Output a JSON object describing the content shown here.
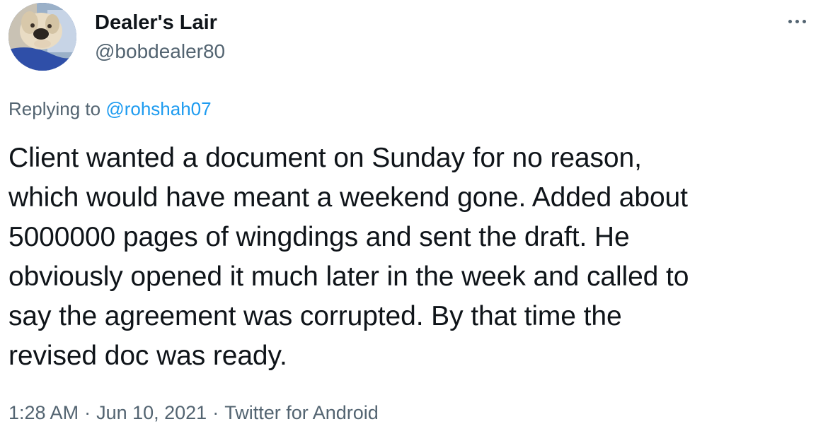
{
  "author": {
    "display_name": "Dealer's Lair",
    "handle": "@bobdealer80",
    "avatar_icon": "dog-photo-avatar"
  },
  "menu": {
    "icon": "more-horizontal-icon",
    "color": "#536471"
  },
  "reply": {
    "prefix": "Replying to",
    "mention": "@rohshah07",
    "mention_color": "#1d9bf0"
  },
  "tweet": {
    "lines": [
      "Client wanted a document on Sunday for no reason,",
      "which would have meant a weekend gone. Added about",
      "5000000 pages of wingdings and sent the draft. He",
      "obviously opened it much later in the week and called to",
      "say the agreement was corrupted. By that time the",
      "revised doc was ready."
    ]
  },
  "meta": {
    "time": "1:28 AM",
    "separator": "·",
    "date": "Jun 10, 2021",
    "source": "Twitter for Android"
  }
}
